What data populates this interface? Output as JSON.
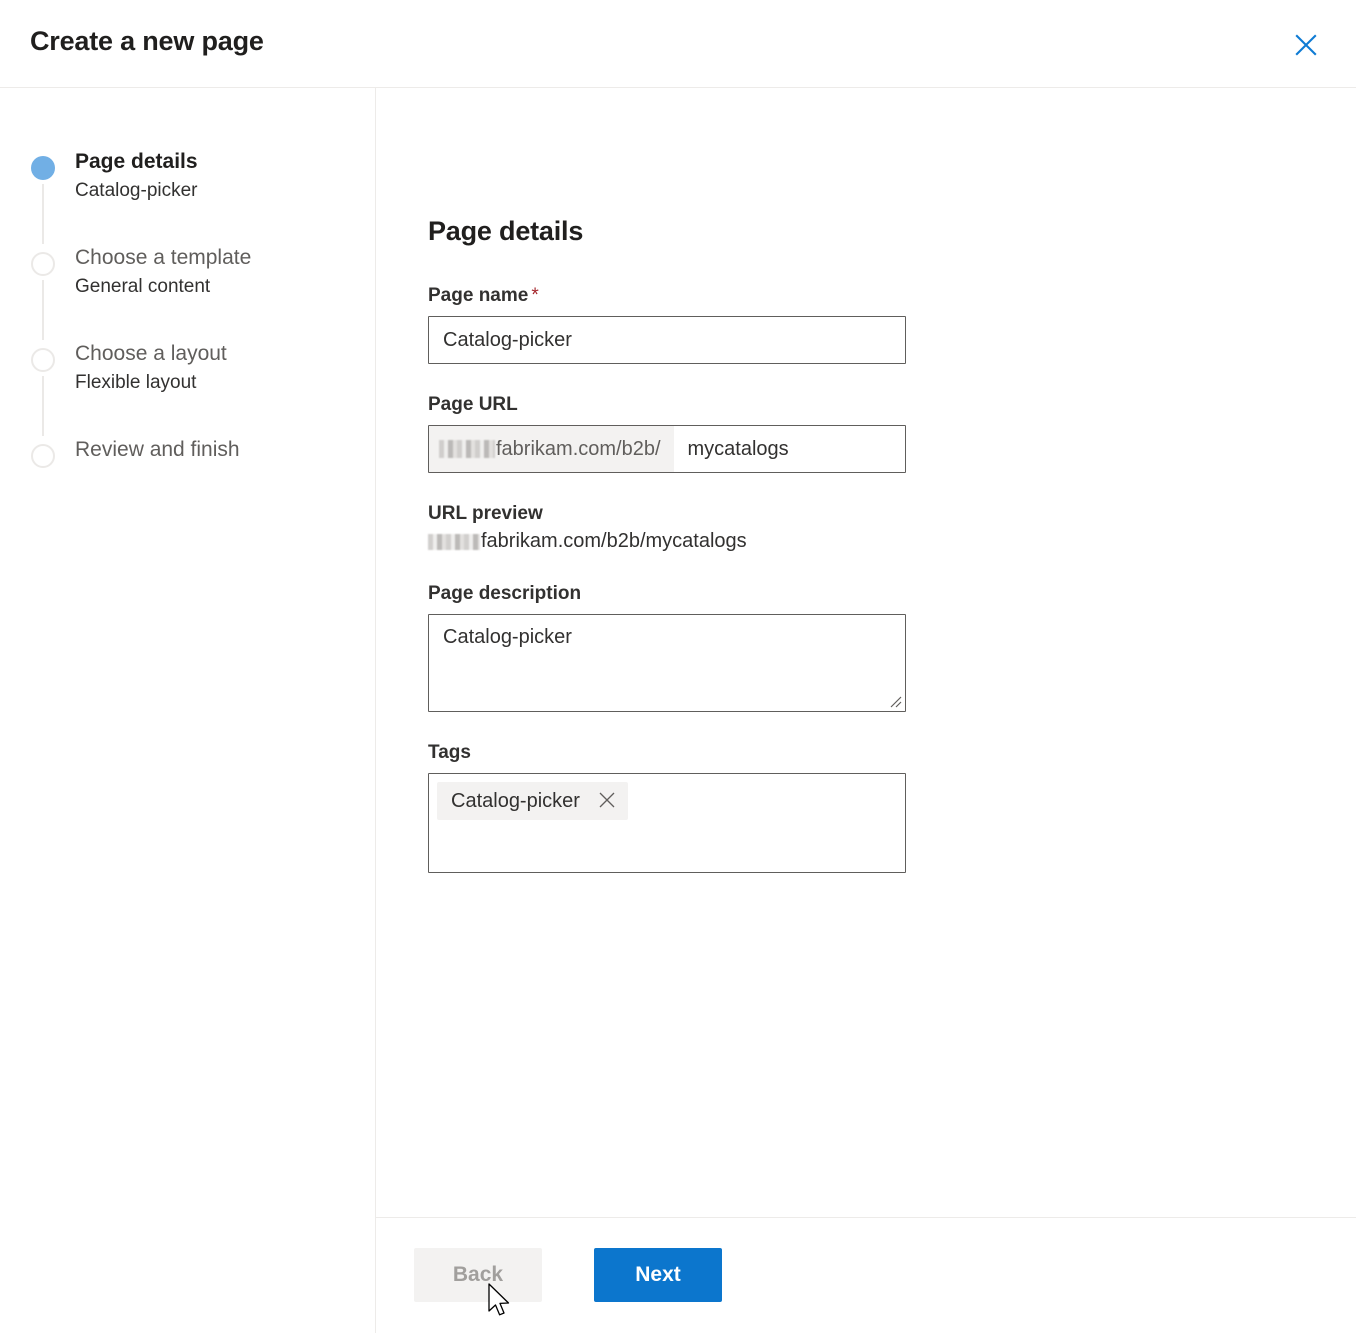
{
  "header": {
    "title": "Create a new page",
    "close_icon": "close-icon",
    "close_color": "#0f7bd4"
  },
  "wizard": {
    "active_color": "#71afe5",
    "steps": [
      {
        "title": "Page details",
        "sub": "Catalog-picker",
        "state": "active"
      },
      {
        "title": "Choose a template",
        "sub": "General content",
        "state": "inactive"
      },
      {
        "title": "Choose a layout",
        "sub": "Flexible layout",
        "state": "inactive"
      },
      {
        "title": "Review and finish",
        "sub": "",
        "state": "inactive"
      }
    ]
  },
  "main": {
    "section_title": "Page details",
    "page_name": {
      "label": "Page name",
      "required_mark": "*",
      "value": "Catalog-picker",
      "placeholder": ""
    },
    "page_url": {
      "label": "Page URL",
      "prefix": "fabrikam.com/b2b/",
      "prefix_redacted": true,
      "value": "mycatalogs",
      "placeholder": ""
    },
    "url_preview": {
      "label": "URL preview",
      "value": "fabrikam.com/b2b/mycatalogs",
      "prefix_redacted": true
    },
    "page_description": {
      "label": "Page description",
      "value": "Catalog-picker",
      "placeholder": ""
    },
    "tags": {
      "label": "Tags",
      "chips": [
        {
          "label": "Catalog-picker",
          "remove_icon": "close-icon"
        }
      ]
    }
  },
  "footer": {
    "back_label": "Back",
    "back_disabled": true,
    "next_label": "Next",
    "next_color": "#0c76cd"
  }
}
